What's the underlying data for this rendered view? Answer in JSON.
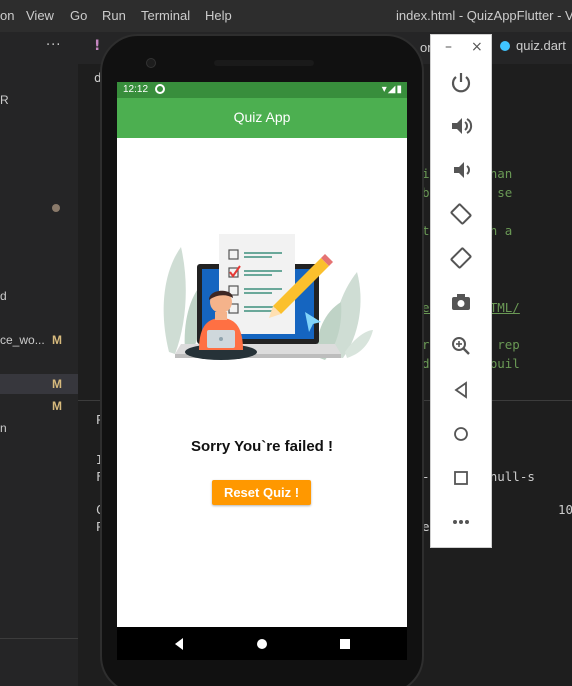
{
  "vscode": {
    "menu": [
      "on",
      "View",
      "Go",
      "Run",
      "Terminal",
      "Help"
    ],
    "window_title": "index.html - QuizAppFlutter - Visu",
    "explorer": {
      "more": "···",
      "rows": [
        {
          "label": "R",
          "mark": ""
        },
        {
          "label": "d",
          "mark": ""
        },
        {
          "label": "ce_wo...",
          "mark": "M"
        },
        {
          "label": "",
          "mark": "M"
        },
        {
          "label": "",
          "mark": "M"
        },
        {
          "label": "n",
          "mark": ""
        }
      ]
    },
    "tabs": {
      "modified_marker": "!",
      "right_fragment": "or",
      "dart_tab": "quiz.dart"
    },
    "code_lines": [
      {
        "text": "d",
        "kind": "w"
      },
      {
        "text": "i    other than",
        "kind": "c"
      },
      {
        "text": "b     you are se",
        "kind": "c"
      },
      {
        "text": "t     end with a",
        "kind": "c"
      },
      {
        "text": "e       s/Web/HTML/",
        "kind": "link"
      },
      {
        "text": "r     will be rep",
        "kind": "c"
      },
      {
        "text": "d     lutter buil",
        "kind": "c"
      },
      {
        "text": "-s     sound-null-s",
        "kind": "w"
      },
      {
        "text": "10",
        "kind": "w"
      },
      {
        "text": "en",
        "kind": "w"
      },
      {
        "text": "P",
        "kind": "w"
      },
      {
        "text": "C",
        "kind": "w"
      },
      {
        "text": "F",
        "kind": "w"
      },
      {
        "text": "I",
        "kind": "w"
      }
    ]
  },
  "phone": {
    "status": {
      "time": "12:12",
      "icons": "▾◢▮"
    },
    "app_title": "Quiz App",
    "result_text": "Sorry You`re failed !",
    "reset_label": "Reset Quiz !",
    "colors": {
      "appbar": "#4caf50",
      "statusbar": "#388e3c",
      "button": "#ff9800"
    }
  },
  "emulator_tools": {
    "window_controls": [
      "–",
      "×"
    ],
    "buttons": [
      "power-icon",
      "volume-up-icon",
      "volume-down-icon",
      "rotate-left-icon",
      "rotate-right-icon",
      "camera-icon",
      "zoom-icon",
      "back-icon",
      "home-icon",
      "overview-icon",
      "more-icon"
    ]
  }
}
